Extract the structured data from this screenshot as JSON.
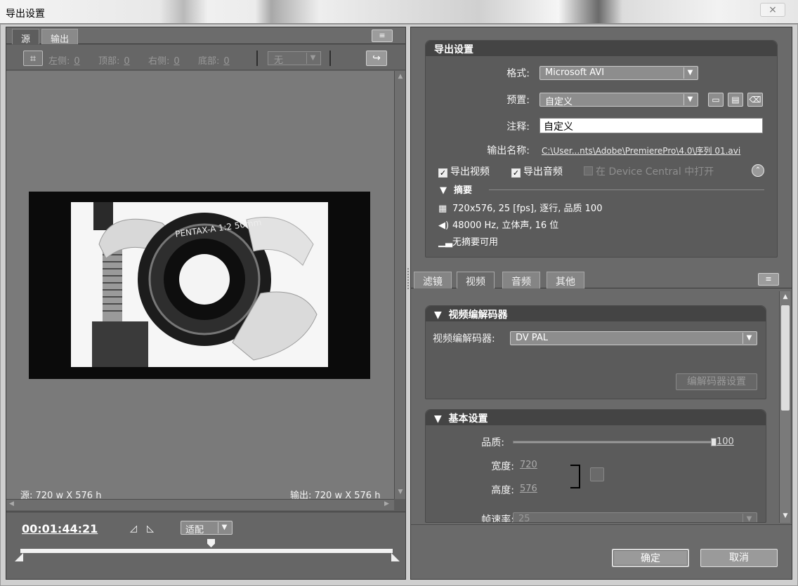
{
  "window": {
    "title": "导出设置",
    "close_label": "⨯"
  },
  "left": {
    "tabs": [
      "源",
      "输出"
    ],
    "menu_icon": "≡",
    "crop": {
      "fields": [
        {
          "label": "左侧:",
          "value": "0"
        },
        {
          "label": "顶部:",
          "value": "0"
        },
        {
          "label": "右侧:",
          "value": "0"
        },
        {
          "label": "底部:",
          "value": "0"
        }
      ],
      "ratio_select": "无"
    },
    "source_size": "源: 720 w X 576 h",
    "output_size": "输出: 720 w X 576 h",
    "timecode": "00:01:44:21",
    "fit_select": "适配"
  },
  "export_settings": {
    "header": "导出设置",
    "format_label": "格式:",
    "format_value": "Microsoft AVI",
    "preset_label": "预置:",
    "preset_value": "自定义",
    "comment_label": "注释:",
    "comment_value": "自定义",
    "output_name_label": "输出名称:",
    "output_name_value": "C:\\User...nts\\Adobe\\PremierePro\\4.0\\序列 01.avi",
    "export_video": "导出视频",
    "export_audio": "导出音频",
    "device_central": "在 Device Central 中打开",
    "summary_header": "摘要",
    "summary_video": "720x576, 25 [fps], 逐行, 品质 100",
    "summary_audio": "48000 Hz, 立体声, 16 位",
    "summary_none": "无摘要可用"
  },
  "tabs": [
    "滤镜",
    "视频",
    "音频",
    "其他"
  ],
  "video_codec": {
    "header": "视频编解码器",
    "codec_label": "视频编解码器:",
    "codec_value": "DV PAL",
    "codec_settings_button": "编解码器设置"
  },
  "basic_settings": {
    "header": "基本设置",
    "quality_label": "品质:",
    "quality_value": "100",
    "quality_fraction": 1.0,
    "width_label": "宽度:",
    "width_value": "720",
    "height_label": "高度:",
    "height_value": "576",
    "framerate_label": "帧速率:",
    "framerate_value": "25"
  },
  "footer": {
    "ok": "确定",
    "cancel": "取消"
  },
  "colors": {
    "panel": "#5d5d5d",
    "header": "#444444",
    "preview": "#7a7a7a"
  }
}
